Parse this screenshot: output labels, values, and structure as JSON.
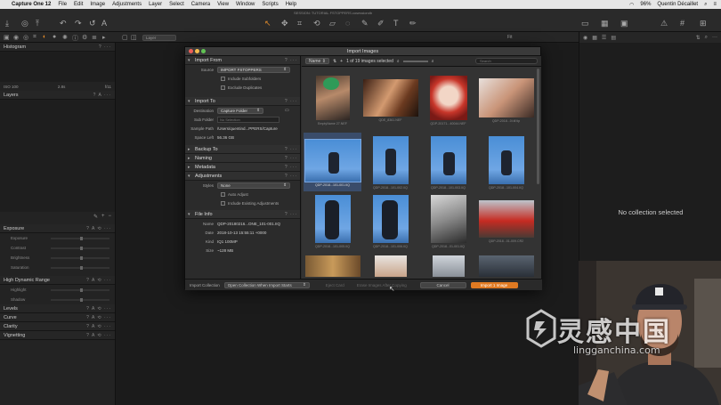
{
  "menubar": {
    "app_name": "Capture One 12",
    "items": [
      "File",
      "Edit",
      "Image",
      "Adjustments",
      "Layer",
      "Select",
      "Camera",
      "View",
      "Window",
      "Scripts",
      "Help"
    ],
    "battery": "96%",
    "user": "Quentin Décaillet"
  },
  "window": {
    "doc_title": "SESSION: TUTORIAL FSTOPPERS.cosessiondb"
  },
  "tabrow": {
    "layer_label": "Layer",
    "fit_label": "Fit"
  },
  "left_panel": {
    "histogram_title": "Histogram",
    "hist_iso": "ISO 100",
    "hist_ev": "2.8s",
    "hist_aperture": "f/11",
    "layers_title": "Layers",
    "exposure_title": "Exposure",
    "exposure_rows": [
      "Exposure",
      "Contrast",
      "Brightness",
      "Saturation"
    ],
    "hdr_title": "High Dynamic Range",
    "hdr_rows": [
      "Highlight",
      "Shadow"
    ],
    "tools": [
      "Levels",
      "Curve",
      "Clarity",
      "Vignetting"
    ]
  },
  "dialog": {
    "title": "Import Images",
    "import_from": {
      "header": "Import From",
      "source_label": "Source",
      "source_value": "IMPORT FSTOPPERS",
      "include_subfolders": "Include Subfolders",
      "exclude_duplicates": "Exclude Duplicates"
    },
    "import_to": {
      "header": "Import To",
      "destination_label": "Destination",
      "destination_value": "Capture Folder",
      "subfolder_label": "Sub Folder",
      "subfolder_placeholder": "No Selection",
      "sample_path_label": "Sample Path",
      "sample_path_value": "/Users/quentind...PPERS/Capture",
      "space_left_label": "Space Left",
      "space_left_value": "56.36 GB"
    },
    "collapsed_sections": [
      "Backup To",
      "Naming",
      "Metadata"
    ],
    "adjustments": {
      "header": "Adjustments",
      "styles_label": "Styles",
      "styles_value": "None",
      "auto_adjust": "Auto Adjust",
      "include_existing": "Include Existing Adjustments"
    },
    "file_info": {
      "header": "File Info",
      "name_label": "Name",
      "name_value": "QDP-20180216...ONE_101-001.IIQ",
      "date_label": "Date",
      "date_value": "2018-10-13 15:55:11 +0000",
      "kind_label": "Kind",
      "kind_value": "IQ1 100MP",
      "size_label": "Size",
      "size_value": "~128 MB"
    },
    "browser": {
      "sort_value": "Name",
      "count_text": "1 of 19 images selected",
      "search_placeholder": "Search",
      "thumbs": [
        {
          "caption": "EmptyName 27.NEF"
        },
        {
          "caption": "QDE_8361.NEF"
        },
        {
          "caption": "QDP-20171...40044.NEF"
        },
        {
          "caption": "QDP-2018...0i.tif.tip"
        },
        {
          "caption": "QDP-2018...101-001.IIQ"
        },
        {
          "caption": "QDP-2018...101-002.IIQ"
        },
        {
          "caption": "QDP-2018...101-003.IIQ"
        },
        {
          "caption": "QDP-2018...101-004.IIQ"
        },
        {
          "caption": "QDP-2018...101-005.IIQ"
        },
        {
          "caption": "QDP-2018...101-006.IIQ"
        },
        {
          "caption": "QDP-2018...01-001.IIQ"
        },
        {
          "caption": "QDP-2018...01-009.CR2"
        }
      ]
    },
    "footer": {
      "collection_label": "Import Collection",
      "collection_value": "Open Collection When Import Starts",
      "eject_label": "Eject Card",
      "erase_label": "Erase Images After Copying",
      "cancel_label": "Cancel",
      "import_label": "Import 1 Image"
    }
  },
  "right_panel": {
    "empty_text": "No collection selected"
  },
  "watermark": {
    "big": "灵感中国",
    "small": "lingganchina.com"
  },
  "colors": {
    "accent": "#e07a22",
    "selection": "#3a4c6a"
  },
  "icons": [
    "apple-icon",
    "wifi-icon",
    "search-icon",
    "gear-icon",
    "question-icon",
    "reset-icon",
    "chevron-down-icon",
    "plus-icon",
    "close-icon",
    "camera-icon"
  ]
}
